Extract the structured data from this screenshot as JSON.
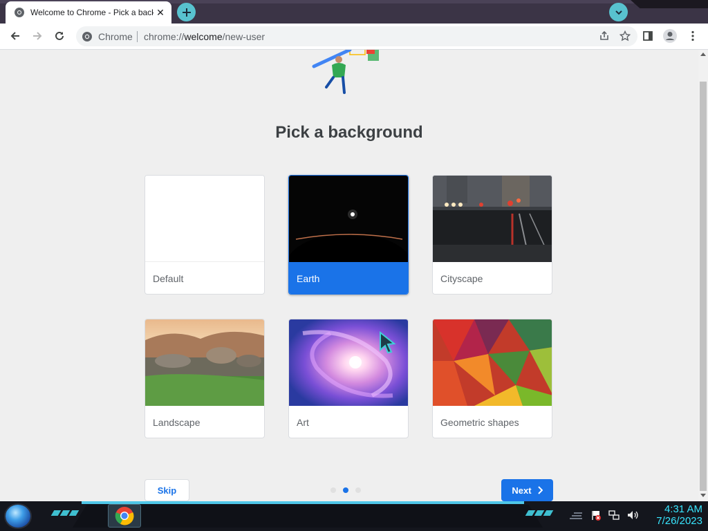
{
  "tab": {
    "title": "Welcome to Chrome - Pick a background",
    "close": "✕"
  },
  "omnibox": {
    "chip": "Chrome",
    "url_prefix": "chrome://",
    "url_host": "welcome",
    "url_path": "/new-user"
  },
  "page": {
    "heading": "Pick a background",
    "cards": [
      {
        "label": "Default"
      },
      {
        "label": "Earth",
        "selected": true
      },
      {
        "label": "Cityscape"
      },
      {
        "label": "Landscape"
      },
      {
        "label": "Art"
      },
      {
        "label": "Geometric shapes"
      }
    ],
    "skip_label": "Skip",
    "next_label": "Next",
    "steps": {
      "count": 3,
      "active": 2
    }
  },
  "colors": {
    "accent": "#1a73e8",
    "tab_strip": "#3b3446",
    "new_tab_button": "#58c2cf",
    "clock": "#38e6ff"
  },
  "icons": [
    "chrome-favicon",
    "plus-icon",
    "chevron-down-icon",
    "back-arrow-icon",
    "forward-arrow-icon",
    "reload-icon",
    "share-icon",
    "star-icon",
    "side-panel-icon",
    "profile-icon",
    "more-icon",
    "chevron-right-icon",
    "cursor-icon",
    "speaker-icon",
    "network-icon",
    "flag-icon"
  ],
  "taskbar": {
    "time": "4:31 AM",
    "date": "7/26/2023"
  }
}
